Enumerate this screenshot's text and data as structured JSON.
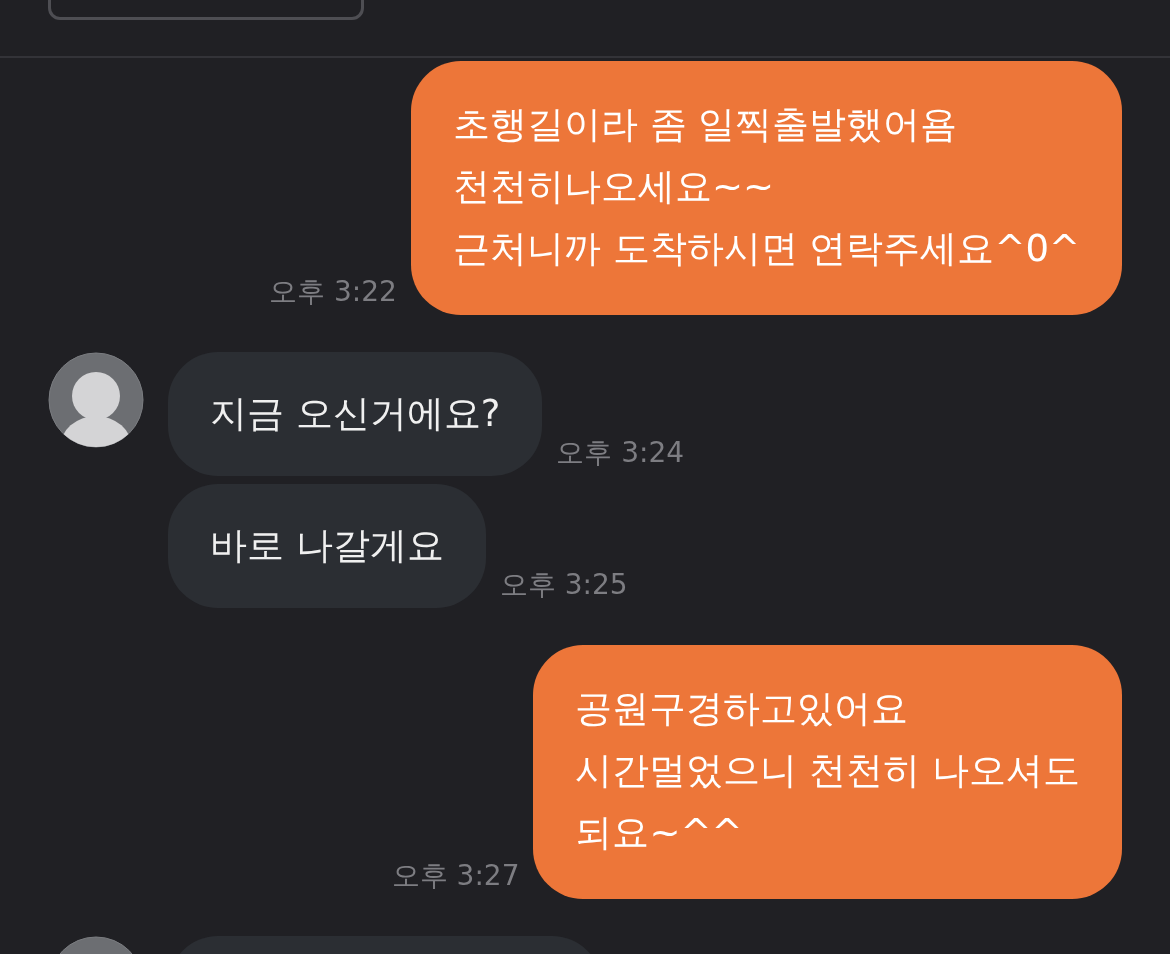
{
  "messages": [
    {
      "kind": "sent",
      "lines": [
        "초행길이라 좀 일찍출발했어욤",
        "천천히나오세요~~",
        "근처니까 도착하시면 연락주세요^0^"
      ],
      "time": "오후 3:22"
    },
    {
      "kind": "received",
      "show_avatar": true,
      "lines": [
        "지금 오신거에요?"
      ],
      "time": "오후 3:24"
    },
    {
      "kind": "received",
      "show_avatar": false,
      "lines": [
        "바로 나갈게요"
      ],
      "time": "오후 3:25"
    },
    {
      "kind": "sent",
      "lines": [
        "공원구경하고있어요",
        "시간멀었으니 천천히 나오셔도",
        "되요~^^"
      ],
      "time": "오후 3:27"
    },
    {
      "kind": "received",
      "show_avatar": true
    }
  ]
}
